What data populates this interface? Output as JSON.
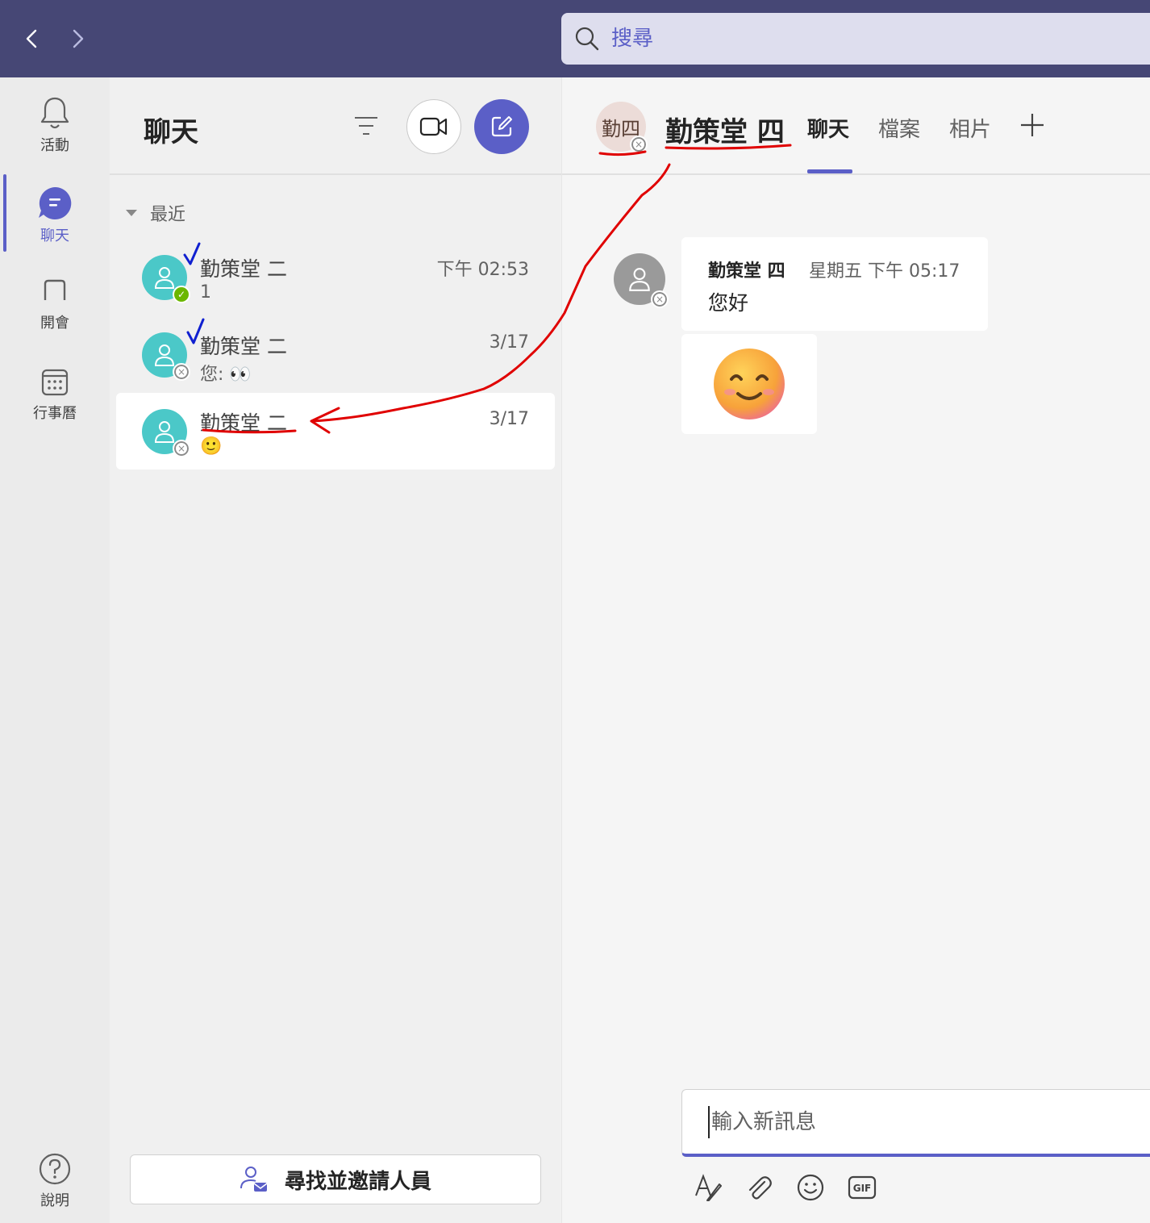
{
  "search": {
    "placeholder": "搜尋"
  },
  "rail": {
    "items": [
      {
        "label": "活動",
        "icon": "bell-icon"
      },
      {
        "label": "聊天",
        "icon": "chat-icon",
        "active": true
      },
      {
        "label": "開會",
        "icon": "meeting-icon"
      },
      {
        "label": "行事曆",
        "icon": "calendar-icon"
      }
    ],
    "help_label": "說明"
  },
  "list": {
    "title": "聊天",
    "section": "最近",
    "chats": [
      {
        "name": "勤策堂 二",
        "time": "下午 02:53",
        "preview": "1",
        "status": "available"
      },
      {
        "name": "勤策堂 二",
        "time": "3/17",
        "preview": "您: 👀",
        "status": "offline"
      },
      {
        "name": "勤策堂 二",
        "time": "3/17",
        "preview": "🙂",
        "status": "offline"
      }
    ],
    "invite_label": "尋找並邀請人員"
  },
  "conversation": {
    "initials": "勤四",
    "title": "勤策堂 四",
    "tabs": [
      "聊天",
      "檔案",
      "相片"
    ],
    "messages": [
      {
        "sender": "勤策堂 四",
        "time": "星期五 下午 05:17",
        "text": "您好"
      },
      {
        "emoji": "😊"
      }
    ],
    "composer_placeholder": "輸入新訊息"
  },
  "colors": {
    "brand": "#464775",
    "accent": "#5b5fc7",
    "annotation": "#e00000"
  }
}
